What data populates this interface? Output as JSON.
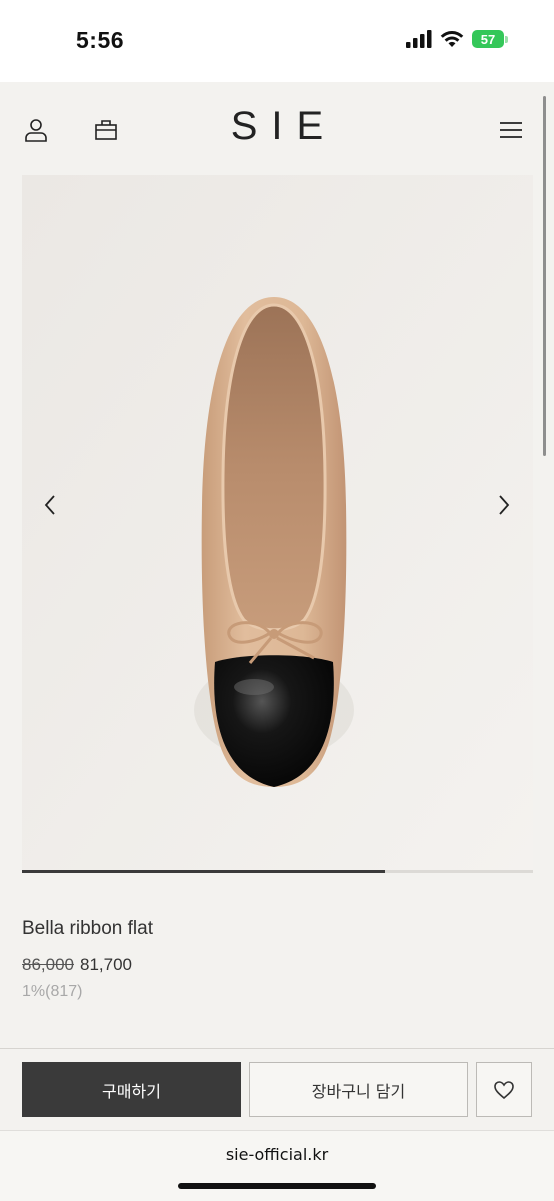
{
  "status_bar": {
    "time": "5:56",
    "battery_percent": "57",
    "icons": [
      "cellular-signal-icon",
      "wifi-icon",
      "battery-icon"
    ]
  },
  "header": {
    "logo": "SIE",
    "icons": [
      "user-icon",
      "bag-icon",
      "menu-icon"
    ]
  },
  "gallery": {
    "image_alt": "beige ballet flat with black cap toe and bow",
    "progress_fraction": 0.71,
    "icons": [
      "chevron-left-icon",
      "chevron-right-icon"
    ]
  },
  "product": {
    "name": "Bella ribbon flat",
    "original_price": "86,000",
    "sale_price": "81,700",
    "discount": "1%(817)"
  },
  "actions": {
    "buy_label": "구매하기",
    "cart_label": "장바구니 담기",
    "wishlist_icon": "heart-icon"
  },
  "browser": {
    "url": "sie-official.kr"
  },
  "colors": {
    "page_background": "#f3f2ef",
    "buy_button": "#3a3a3a",
    "battery": "#34c759",
    "shoe_upper": "#d9b391",
    "shoe_toe": "#0c0c0c"
  }
}
